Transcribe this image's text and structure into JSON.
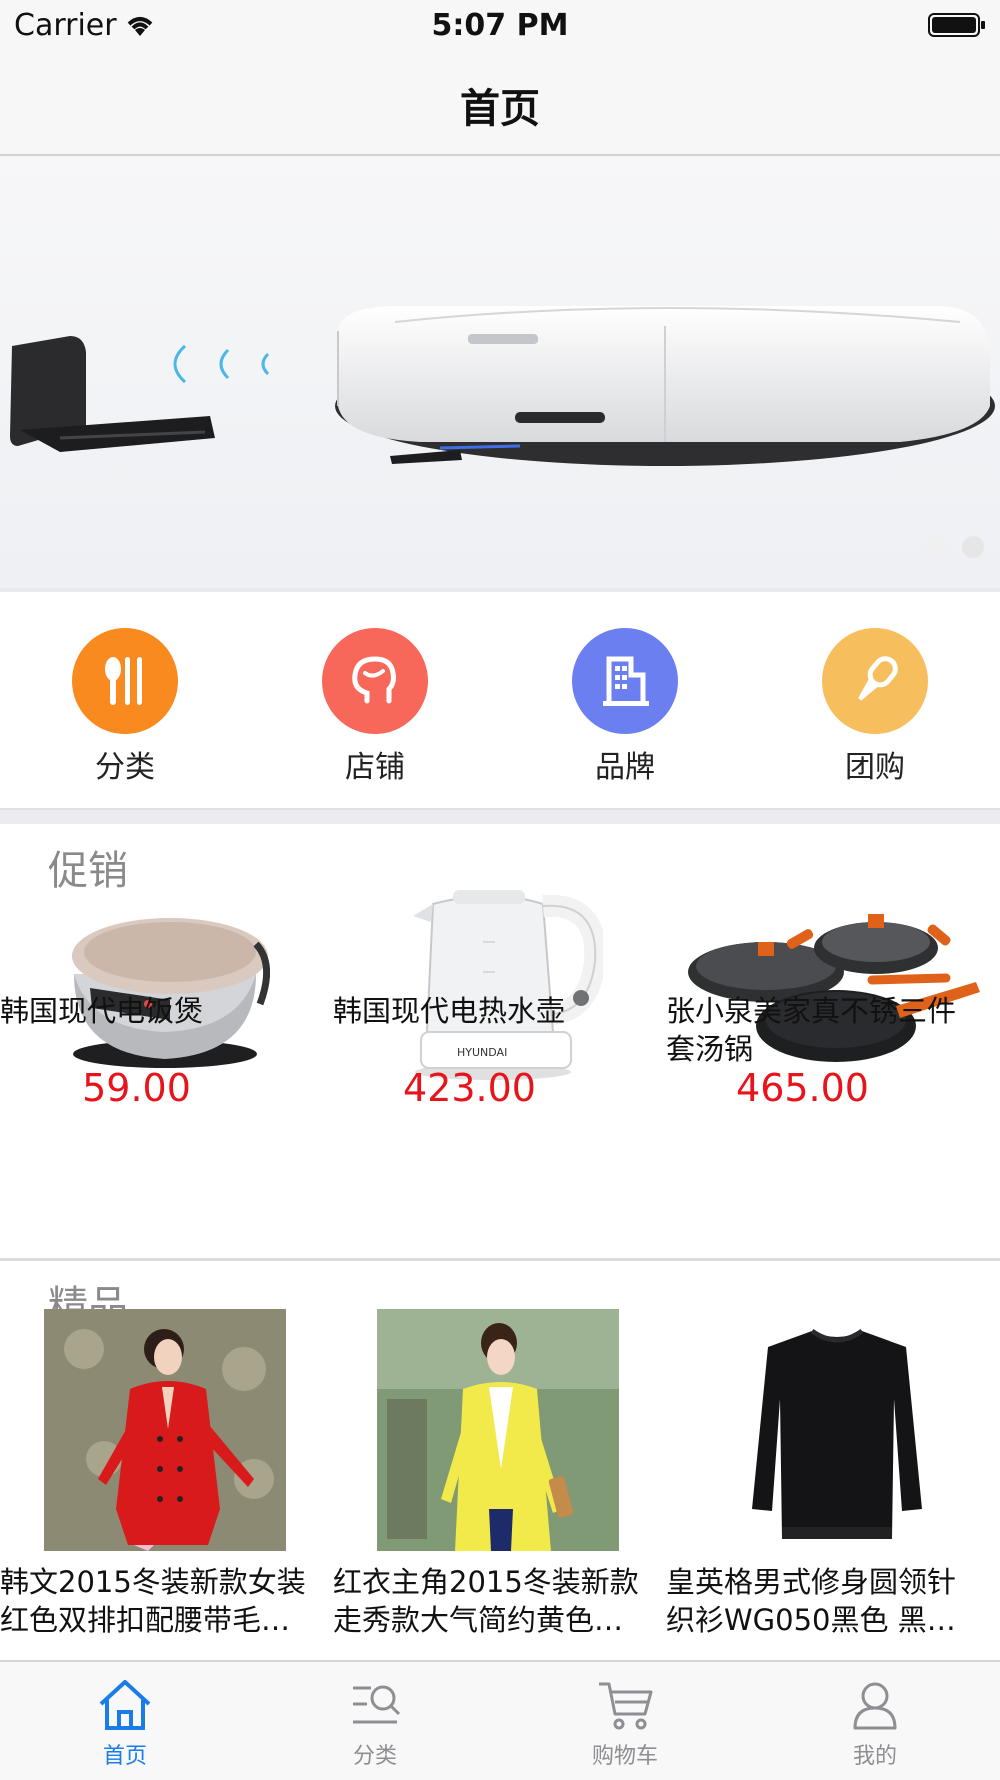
{
  "status_bar": {
    "carrier": "Carrier",
    "time": "5:07 PM"
  },
  "nav": {
    "title": "首页"
  },
  "quick_categories": [
    {
      "label": "分类",
      "icon": "utensils-icon",
      "color": "#f98a1f"
    },
    {
      "label": "店铺",
      "icon": "person-profile-icon",
      "color": "#f8685a"
    },
    {
      "label": "品牌",
      "icon": "building-icon",
      "color": "#6b7ff0"
    },
    {
      "label": "团购",
      "icon": "microphone-icon",
      "color": "#f7be5d"
    }
  ],
  "promo": {
    "title": "促销",
    "items": [
      {
        "name": "韩国现代电饭煲",
        "price": "59.00",
        "image": "rice-cooker-image"
      },
      {
        "name": "韩国现代电热水壶",
        "price": "423.00",
        "image": "electric-kettle-image"
      },
      {
        "name_lines": [
          "张小泉美家真不锈三件",
          "套汤锅"
        ],
        "price": "465.00",
        "image": "cookware-set-image"
      }
    ]
  },
  "featured": {
    "title": "精品",
    "items": [
      {
        "line1": "韩文2015冬装新款女装",
        "line2": "红色双排扣配腰带毛…",
        "image": "red-coat-image"
      },
      {
        "line1": "红衣主角2015冬装新款",
        "line2": "走秀款大气简约黄色…",
        "image": "yellow-coat-image"
      },
      {
        "line1": "皇英格男式修身圆领针",
        "line2": "织衫WG050黑色 黑…",
        "image": "black-sweater-image"
      }
    ]
  },
  "tabs": [
    {
      "label": "首页",
      "icon": "home-icon",
      "active": true
    },
    {
      "label": "分类",
      "icon": "category-search-icon",
      "active": false
    },
    {
      "label": "购物车",
      "icon": "cart-icon",
      "active": false
    },
    {
      "label": "我的",
      "icon": "user-icon",
      "active": false
    }
  ],
  "colors": {
    "accent": "#1a7ce8",
    "price": "#e8141c",
    "section_title": "#8a8a8a"
  }
}
